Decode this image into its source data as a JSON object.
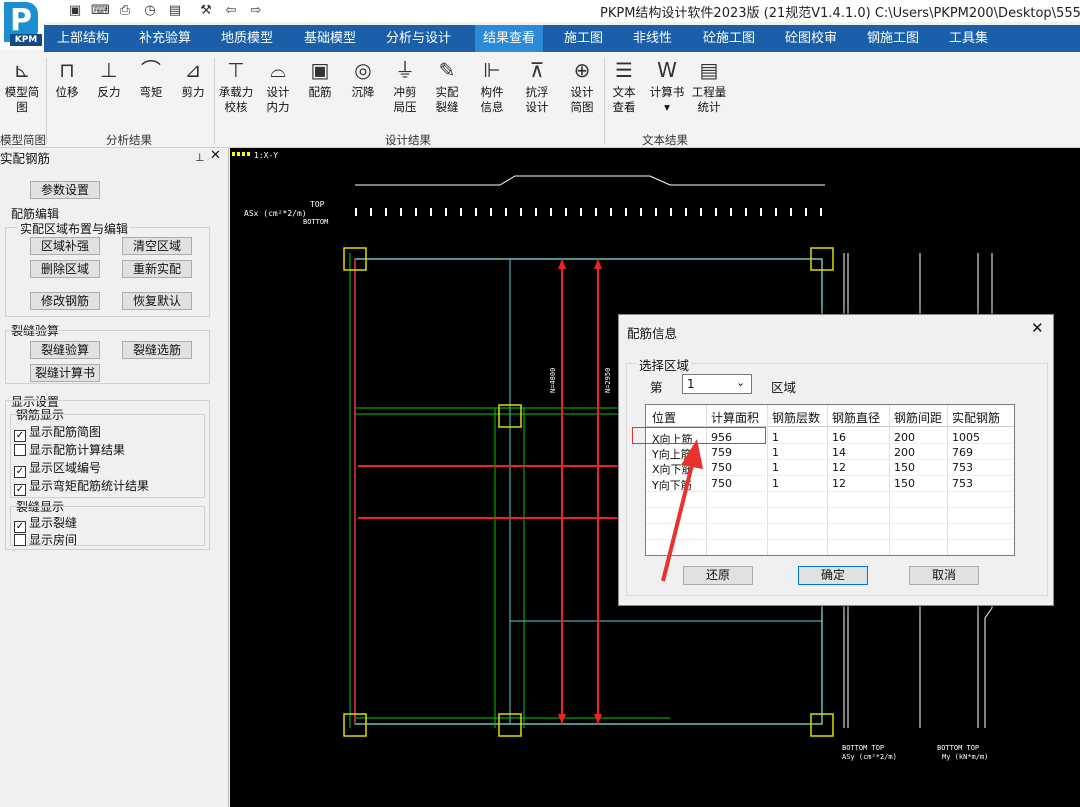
{
  "app": {
    "title": "PKPM结构设计软件2023版 (21规范V1.4.1.0) C:\\Users\\PKPM200\\Desktop\\555",
    "logo_text": "P",
    "logo_sub": "KPM"
  },
  "menu": {
    "items": [
      "上部结构",
      "补充验算",
      "地质模型",
      "基础模型",
      "分析与设计",
      "结果查看",
      "施工图",
      "非线性",
      "砼施工图",
      "砼图校审",
      "钢施工图",
      "工具集"
    ],
    "active": "结果查看"
  },
  "ribbon": {
    "buttons": [
      "模型简图",
      "位移",
      "反力",
      "弯矩",
      "剪力",
      "承载力\n校核",
      "设计\n内力",
      "配筋",
      "沉降",
      "冲剪\n局压",
      "实配\n裂缝",
      "构件\n信息",
      "抗浮\n设计",
      "设计\n简图",
      "文本\n查看",
      "计算书",
      "工程量\n统计"
    ],
    "groups": [
      "模型简图",
      "分析结果",
      "设计结果",
      "文本结果"
    ]
  },
  "panel": {
    "title": "实配钢筋",
    "param_button": "参数设置",
    "rebar_edit_title": "配筋编辑",
    "region_group_title": "实配区域布置与编辑",
    "region_buttons": [
      "区域补强",
      "清空区域",
      "删除区域",
      "重新实配"
    ],
    "modify_buttons": [
      "修改钢筋",
      "恢复默认"
    ],
    "crack_title": "裂缝验算",
    "crack_buttons": [
      "裂缝验算",
      "裂缝选筋",
      "裂缝计算书"
    ],
    "display_title": "显示设置",
    "rebar_display_title": "钢筋显示",
    "rebar_checks": [
      {
        "label": "显示配筋简图",
        "checked": true
      },
      {
        "label": "显示配筋计算结果",
        "checked": false
      },
      {
        "label": "显示区域编号",
        "checked": true
      },
      {
        "label": "显示弯矩配筋统计结果",
        "checked": true
      }
    ],
    "crack_display_title": "裂缝显示",
    "crack_checks": [
      {
        "label": "显示裂缝",
        "checked": true
      },
      {
        "label": "显示房间",
        "checked": false
      }
    ]
  },
  "drawing": {
    "view_label": "1:X-Y",
    "top_left_labels": [
      "ASx (cm²*2/m)",
      "TOP",
      "BOTTOM"
    ],
    "bottom_right_labels": [
      "BOTTOM  TOP",
      "ASy (cm²*2/m)",
      "BOTTOM  TOP",
      "My (kN*m/m)"
    ],
    "dim_labels": [
      "N=4800",
      "N=2950"
    ]
  },
  "dialog": {
    "title": "配筋信息",
    "section": "选择区域",
    "prefix": "第",
    "region_value": "1",
    "suffix": "区域",
    "columns": [
      "位置",
      "计算面积",
      "钢筋层数",
      "钢筋直径",
      "钢筋间距",
      "实配钢筋"
    ],
    "rows": [
      [
        "X向上筋",
        "956",
        "1",
        "16",
        "200",
        "1005"
      ],
      [
        "Y向上筋",
        "759",
        "1",
        "14",
        "200",
        "769"
      ],
      [
        "X向下筋",
        "750",
        "1",
        "12",
        "150",
        "753"
      ],
      [
        "Y向下筋",
        "750",
        "1",
        "12",
        "150",
        "753"
      ]
    ],
    "buttons": [
      "还原",
      "确定",
      "取消"
    ],
    "highlight_color": "#e8322d"
  }
}
